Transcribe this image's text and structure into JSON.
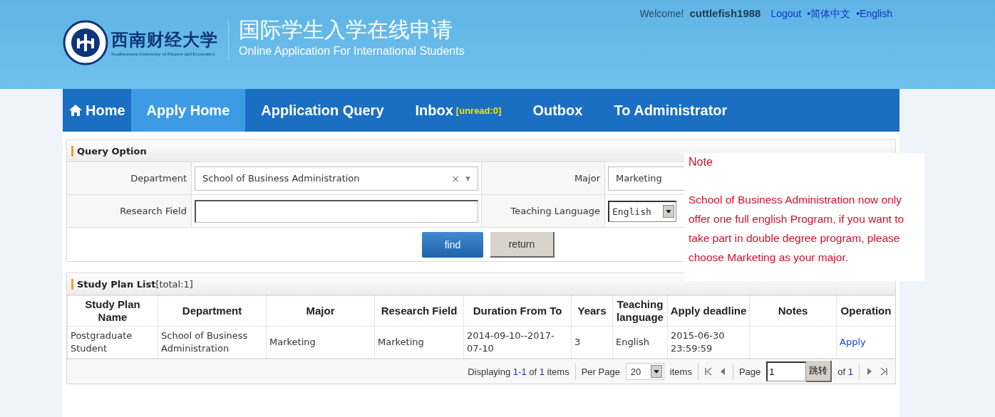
{
  "header": {
    "logo_cn": "西南财经大学",
    "logo_en": "Southwestern University of Finance and Economics",
    "title_cn": "国际学生入学在线申请",
    "title_en": "Online Application For International Students"
  },
  "user_bar": {
    "welcome": "Welcome!",
    "username": "cuttlefish1988",
    "links": [
      "Logout",
      "•简体中文",
      "•English"
    ]
  },
  "nav": [
    {
      "label": "Home",
      "kind": "home",
      "selected": false
    },
    {
      "label": "Apply Home",
      "kind": "plain",
      "selected": true
    },
    {
      "label": "Application Query",
      "kind": "plain",
      "selected": false
    },
    {
      "label": "Inbox",
      "kind": "badge",
      "badge": "[unread:0]",
      "selected": false
    },
    {
      "label": "Outbox",
      "kind": "plain",
      "selected": false
    },
    {
      "label": "To Administrator",
      "kind": "plain",
      "selected": false
    }
  ],
  "query": {
    "title": "Query Option",
    "department": {
      "label": "Department",
      "value": "School of Business Administration",
      "clear": "×",
      "arrow": "▼"
    },
    "major": {
      "label": "Major",
      "value": "Marketing"
    },
    "research_field": {
      "label": "Research Field"
    },
    "teaching_language": {
      "label": "Teaching Language",
      "value": "English"
    },
    "buttons": [
      {
        "label": "find",
        "kind": "primary"
      },
      {
        "label": "return",
        "kind": "secondary"
      }
    ]
  },
  "note": {
    "title": "Note",
    "text": "School of Business Administration now only offer one full english Program, if you want to take part in double degree program, please choose Marketing as your major."
  },
  "list": {
    "title": "Study Plan List",
    "total": "[total:1]",
    "columns": [
      "Study Plan Name",
      "Department",
      "Major",
      "Research Field",
      "Duration From To",
      "Years",
      "Teaching language",
      "Apply deadline",
      "Notes",
      "Operation"
    ],
    "rows": [
      [
        {
          "text": "Postgraduate Student",
          "kind": "text"
        },
        {
          "text": "School of Business Administration",
          "kind": "text"
        },
        {
          "text": "Marketing",
          "kind": "text"
        },
        {
          "text": "Marketing",
          "kind": "text"
        },
        {
          "text": "2014-09-10--2017-07-10",
          "kind": "text"
        },
        {
          "text": "3",
          "kind": "text"
        },
        {
          "text": "English",
          "kind": "text"
        },
        {
          "text": "2015-06-30 23:59:59",
          "kind": "text"
        },
        null,
        {
          "text": "Apply",
          "kind": "link"
        }
      ]
    ]
  },
  "pager": {
    "displaying": "Displaying",
    "range": "1-1",
    "of": "of",
    "total": "1",
    "items": "items",
    "per_page_label": "Per Page",
    "per_page": "20",
    "items_label": "items",
    "page_label": "Page",
    "page": "1",
    "go": "跳转",
    "of_label": "of",
    "pages": "1"
  }
}
